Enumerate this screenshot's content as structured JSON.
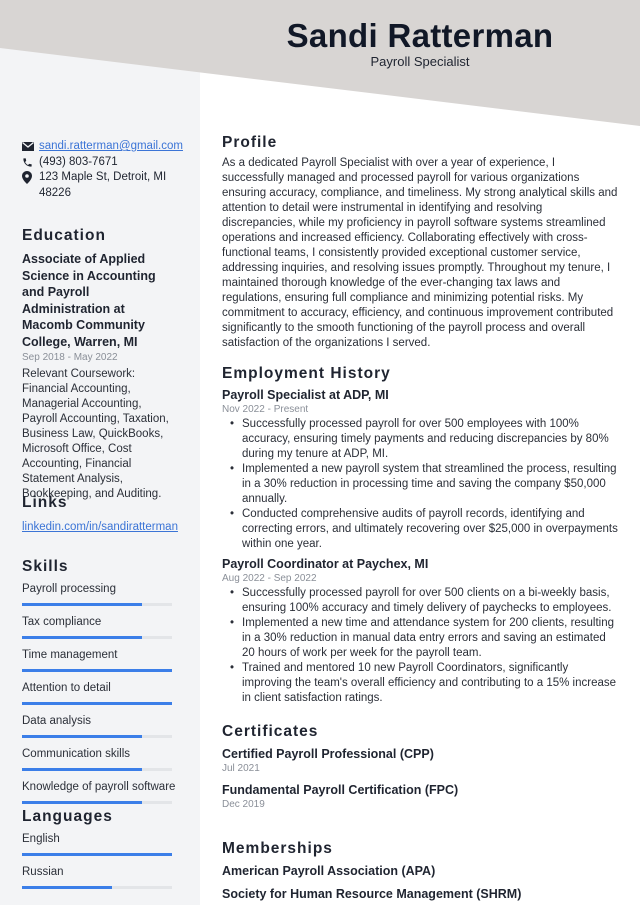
{
  "header": {
    "name": "Sandi Ratterman",
    "role": "Payroll Specialist",
    "background_color": "#d8d5d3"
  },
  "contact": {
    "email": "sandi.ratterman@gmail.com",
    "phone": "(493) 803-7671",
    "address_line1": "123 Maple St, Detroit, MI",
    "address_line2": "48226",
    "icons": [
      "envelope-icon",
      "phone-icon",
      "map-pin-icon"
    ]
  },
  "education": {
    "title": "Education",
    "degree": "Associate of Applied Science in Accounting and Payroll Administration at Macomb Community College, Warren, MI",
    "dates": "Sep 2018 - May 2022",
    "coursework": "Relevant Coursework: Financial Accounting, Managerial Accounting, Payroll Accounting, Taxation, Business Law, QuickBooks, Microsoft Office, Cost Accounting, Financial Statement Analysis, Bookkeeping, and Auditing."
  },
  "links": {
    "title": "Links",
    "items": [
      {
        "label": "linkedin.com/in/sandiratterman"
      }
    ]
  },
  "skills": {
    "title": "Skills",
    "items": [
      {
        "label": "Payroll processing",
        "level": 0.8
      },
      {
        "label": "Tax compliance",
        "level": 0.8
      },
      {
        "label": "Time management",
        "level": 1.0
      },
      {
        "label": "Attention to detail",
        "level": 1.0
      },
      {
        "label": "Data analysis",
        "level": 0.8
      },
      {
        "label": "Communication skills",
        "level": 0.8
      },
      {
        "label": "Knowledge of payroll software",
        "level": 0.8
      }
    ]
  },
  "languages": {
    "title": "Languages",
    "items": [
      {
        "label": "English",
        "level": 1.0
      },
      {
        "label": "Russian",
        "level": 0.6
      }
    ]
  },
  "profile": {
    "title": "Profile",
    "text": "As a dedicated Payroll Specialist with over a year of experience, I successfully managed and processed payroll for various organizations ensuring accuracy, compliance, and timeliness. My strong analytical skills and attention to detail were instrumental in identifying and resolving discrepancies, while my proficiency in payroll software systems streamlined operations and increased efficiency. Collaborating effectively with cross-functional teams, I consistently provided exceptional customer service, addressing inquiries, and resolving issues promptly. Throughout my tenure, I maintained thorough knowledge of the ever-changing tax laws and regulations, ensuring full compliance and minimizing potential risks. My commitment to accuracy, efficiency, and continuous improvement contributed significantly to the smooth functioning of the payroll process and overall satisfaction of the organizations I served."
  },
  "employment": {
    "title": "Employment History",
    "jobs": [
      {
        "title": "Payroll Specialist at ADP, MI",
        "dates": "Nov 2022 - Present",
        "bullets": [
          "Successfully processed payroll for over 500 employees with 100% accuracy, ensuring timely payments and reducing discrepancies by 80% during my tenure at ADP, MI.",
          "Implemented a new payroll system that streamlined the process, resulting in a 30% reduction in processing time and saving the company $50,000 annually.",
          "Conducted comprehensive audits of payroll records, identifying and correcting errors, and ultimately recovering over $25,000 in overpayments within one year."
        ]
      },
      {
        "title": "Payroll Coordinator at Paychex, MI",
        "dates": "Aug 2022 - Sep 2022",
        "bullets": [
          "Successfully processed payroll for over 500 clients on a bi-weekly basis, ensuring 100% accuracy and timely delivery of paychecks to employees.",
          "Implemented a new time and attendance system for 200 clients, resulting in a 30% reduction in manual data entry errors and saving an estimated 20 hours of work per week for the payroll team.",
          "Trained and mentored 10 new Payroll Coordinators, significantly improving the team's overall efficiency and contributing to a 15% increase in client satisfaction ratings."
        ]
      }
    ]
  },
  "certificates": {
    "title": "Certificates",
    "items": [
      {
        "name": "Certified Payroll Professional (CPP)",
        "date": "Jul 2021"
      },
      {
        "name": "Fundamental Payroll Certification (FPC)",
        "date": "Dec 2019"
      }
    ]
  },
  "memberships": {
    "title": "Memberships",
    "items": [
      {
        "name": "American Payroll Association (APA)"
      },
      {
        "name": "Society for Human Resource Management (SHRM)"
      }
    ]
  },
  "colors": {
    "accent": "#3b7ee8",
    "link": "#3b74d6",
    "sidebar": "#f3f4f6"
  }
}
